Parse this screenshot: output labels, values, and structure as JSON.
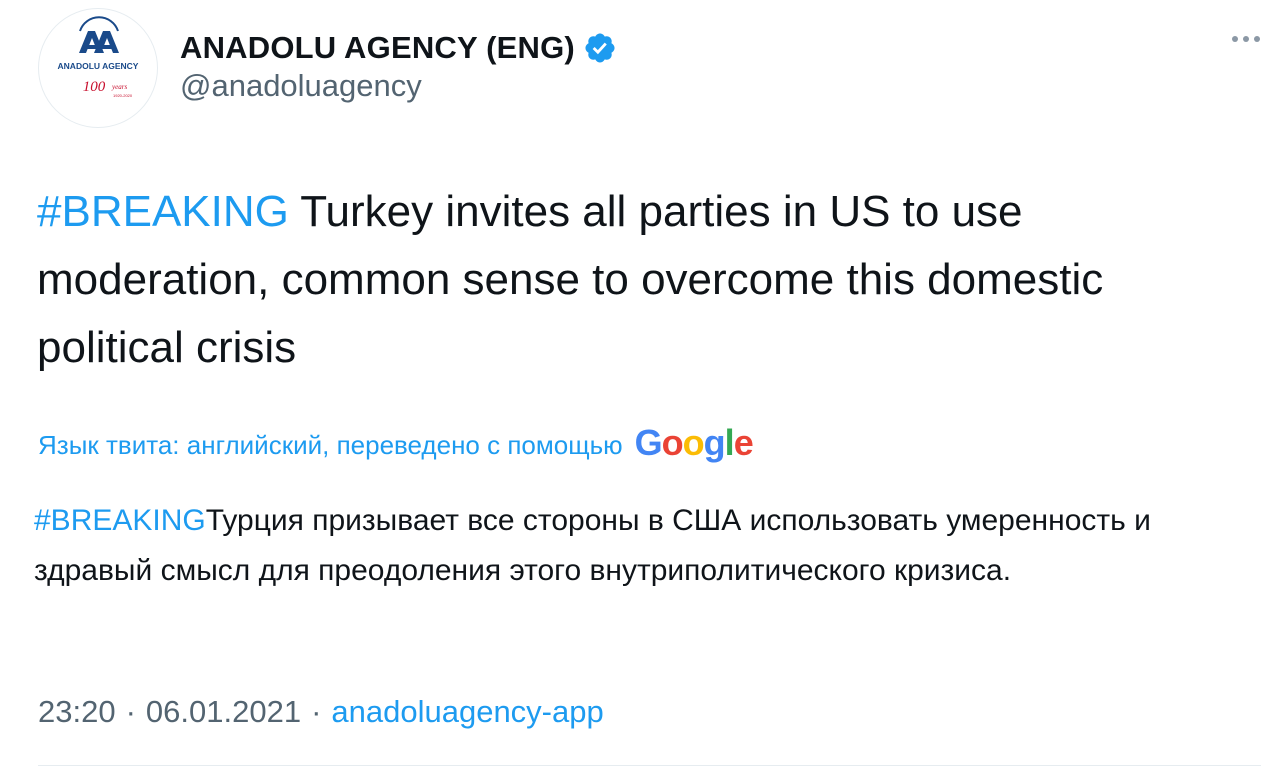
{
  "author": {
    "display_name": "ANADOLU AGENCY (ENG)",
    "handle": "@anadoluagency",
    "verified": true,
    "avatar_icon": "anadolu-agency-logo",
    "avatar_text": {
      "brand": "ANADOLU AGENCY",
      "anniversary": "100",
      "anniversary_word": "years",
      "years_range": "1920-2020"
    }
  },
  "tweet": {
    "hashtag": "#BREAKING",
    "text": " Turkey invites all parties in US to use moderation, common sense to overcome this domestic political crisis",
    "translation_note": "Язык твита: английский, переведено с помощью",
    "translation_provider": "Google",
    "translated_hashtag": "#BREAKING",
    "translated_text": "Турция призывает все стороны в США использовать умеренность и здравый смысл для преодоления этого внутриполитического кризиса.",
    "time": "23:20",
    "date": "06.01.2021",
    "separator": "·",
    "source": "anadoluagency-app"
  },
  "icons": {
    "more": "more-dots-icon",
    "verified": "verified-badge-icon"
  },
  "colors": {
    "accent": "#1d9bf0",
    "text": "#0f1419",
    "secondary": "#536471",
    "logo_blue": "#1a4a8a",
    "logo_red": "#c8102e"
  }
}
